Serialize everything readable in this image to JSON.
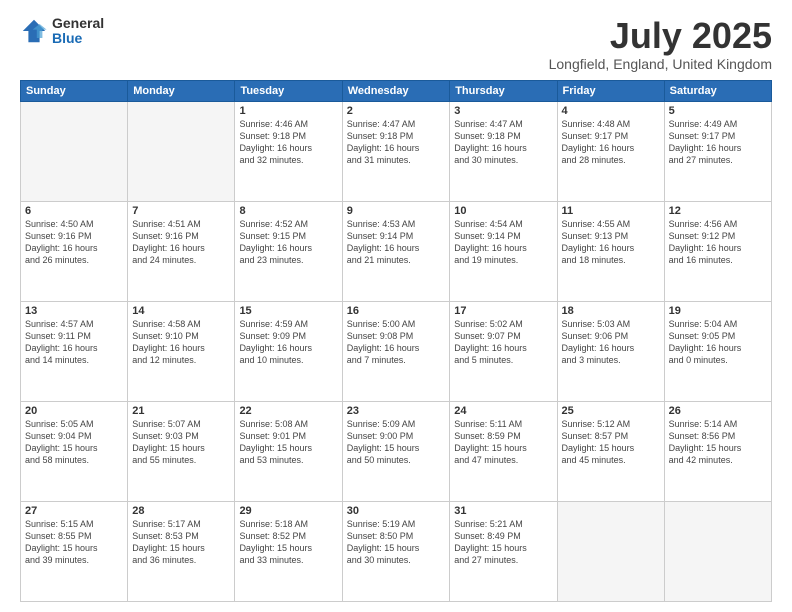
{
  "logo": {
    "general": "General",
    "blue": "Blue"
  },
  "title": "July 2025",
  "subtitle": "Longfield, England, United Kingdom",
  "days_header": [
    "Sunday",
    "Monday",
    "Tuesday",
    "Wednesday",
    "Thursday",
    "Friday",
    "Saturday"
  ],
  "weeks": [
    [
      {
        "day": "",
        "info": ""
      },
      {
        "day": "",
        "info": ""
      },
      {
        "day": "1",
        "info": "Sunrise: 4:46 AM\nSunset: 9:18 PM\nDaylight: 16 hours\nand 32 minutes."
      },
      {
        "day": "2",
        "info": "Sunrise: 4:47 AM\nSunset: 9:18 PM\nDaylight: 16 hours\nand 31 minutes."
      },
      {
        "day": "3",
        "info": "Sunrise: 4:47 AM\nSunset: 9:18 PM\nDaylight: 16 hours\nand 30 minutes."
      },
      {
        "day": "4",
        "info": "Sunrise: 4:48 AM\nSunset: 9:17 PM\nDaylight: 16 hours\nand 28 minutes."
      },
      {
        "day": "5",
        "info": "Sunrise: 4:49 AM\nSunset: 9:17 PM\nDaylight: 16 hours\nand 27 minutes."
      }
    ],
    [
      {
        "day": "6",
        "info": "Sunrise: 4:50 AM\nSunset: 9:16 PM\nDaylight: 16 hours\nand 26 minutes."
      },
      {
        "day": "7",
        "info": "Sunrise: 4:51 AM\nSunset: 9:16 PM\nDaylight: 16 hours\nand 24 minutes."
      },
      {
        "day": "8",
        "info": "Sunrise: 4:52 AM\nSunset: 9:15 PM\nDaylight: 16 hours\nand 23 minutes."
      },
      {
        "day": "9",
        "info": "Sunrise: 4:53 AM\nSunset: 9:14 PM\nDaylight: 16 hours\nand 21 minutes."
      },
      {
        "day": "10",
        "info": "Sunrise: 4:54 AM\nSunset: 9:14 PM\nDaylight: 16 hours\nand 19 minutes."
      },
      {
        "day": "11",
        "info": "Sunrise: 4:55 AM\nSunset: 9:13 PM\nDaylight: 16 hours\nand 18 minutes."
      },
      {
        "day": "12",
        "info": "Sunrise: 4:56 AM\nSunset: 9:12 PM\nDaylight: 16 hours\nand 16 minutes."
      }
    ],
    [
      {
        "day": "13",
        "info": "Sunrise: 4:57 AM\nSunset: 9:11 PM\nDaylight: 16 hours\nand 14 minutes."
      },
      {
        "day": "14",
        "info": "Sunrise: 4:58 AM\nSunset: 9:10 PM\nDaylight: 16 hours\nand 12 minutes."
      },
      {
        "day": "15",
        "info": "Sunrise: 4:59 AM\nSunset: 9:09 PM\nDaylight: 16 hours\nand 10 minutes."
      },
      {
        "day": "16",
        "info": "Sunrise: 5:00 AM\nSunset: 9:08 PM\nDaylight: 16 hours\nand 7 minutes."
      },
      {
        "day": "17",
        "info": "Sunrise: 5:02 AM\nSunset: 9:07 PM\nDaylight: 16 hours\nand 5 minutes."
      },
      {
        "day": "18",
        "info": "Sunrise: 5:03 AM\nSunset: 9:06 PM\nDaylight: 16 hours\nand 3 minutes."
      },
      {
        "day": "19",
        "info": "Sunrise: 5:04 AM\nSunset: 9:05 PM\nDaylight: 16 hours\nand 0 minutes."
      }
    ],
    [
      {
        "day": "20",
        "info": "Sunrise: 5:05 AM\nSunset: 9:04 PM\nDaylight: 15 hours\nand 58 minutes."
      },
      {
        "day": "21",
        "info": "Sunrise: 5:07 AM\nSunset: 9:03 PM\nDaylight: 15 hours\nand 55 minutes."
      },
      {
        "day": "22",
        "info": "Sunrise: 5:08 AM\nSunset: 9:01 PM\nDaylight: 15 hours\nand 53 minutes."
      },
      {
        "day": "23",
        "info": "Sunrise: 5:09 AM\nSunset: 9:00 PM\nDaylight: 15 hours\nand 50 minutes."
      },
      {
        "day": "24",
        "info": "Sunrise: 5:11 AM\nSunset: 8:59 PM\nDaylight: 15 hours\nand 47 minutes."
      },
      {
        "day": "25",
        "info": "Sunrise: 5:12 AM\nSunset: 8:57 PM\nDaylight: 15 hours\nand 45 minutes."
      },
      {
        "day": "26",
        "info": "Sunrise: 5:14 AM\nSunset: 8:56 PM\nDaylight: 15 hours\nand 42 minutes."
      }
    ],
    [
      {
        "day": "27",
        "info": "Sunrise: 5:15 AM\nSunset: 8:55 PM\nDaylight: 15 hours\nand 39 minutes."
      },
      {
        "day": "28",
        "info": "Sunrise: 5:17 AM\nSunset: 8:53 PM\nDaylight: 15 hours\nand 36 minutes."
      },
      {
        "day": "29",
        "info": "Sunrise: 5:18 AM\nSunset: 8:52 PM\nDaylight: 15 hours\nand 33 minutes."
      },
      {
        "day": "30",
        "info": "Sunrise: 5:19 AM\nSunset: 8:50 PM\nDaylight: 15 hours\nand 30 minutes."
      },
      {
        "day": "31",
        "info": "Sunrise: 5:21 AM\nSunset: 8:49 PM\nDaylight: 15 hours\nand 27 minutes."
      },
      {
        "day": "",
        "info": ""
      },
      {
        "day": "",
        "info": ""
      }
    ]
  ]
}
